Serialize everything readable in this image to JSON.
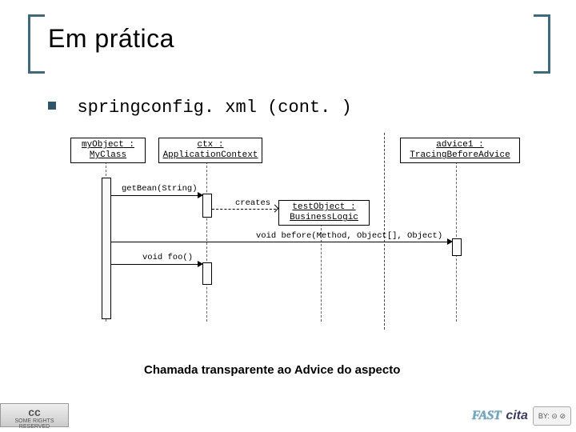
{
  "title": "Em prática",
  "bullet": "springconfig. xml (cont. )",
  "caption": "Chamada transparente ao Advice do aspecto",
  "footer": {
    "left_top": "cc",
    "left_bottom": "SOME RIGHTS RESERVED",
    "fast": "FAST",
    "cita": "cita",
    "by": "BY:"
  },
  "chart_data": {
    "type": "sequence-diagram",
    "objects": [
      {
        "name": "myObject",
        "class": "MyClass",
        "kind": "header"
      },
      {
        "name": "ctx",
        "class": "ApplicationContext",
        "kind": "header"
      },
      {
        "name": "testObject",
        "class": "BusinessLogic",
        "kind": "created-midway"
      },
      {
        "name": "advice1",
        "class": "TracingBeforeAdvice",
        "kind": "header"
      }
    ],
    "messages": [
      {
        "from": "myObject",
        "to": "ctx",
        "label": "getBean(String)",
        "style": "sync"
      },
      {
        "from": "ctx",
        "to": "testObject",
        "label": "creates",
        "style": "dashed"
      },
      {
        "from": "myObject",
        "to": "advice1",
        "label": "void before(Method, Object[], Object)",
        "style": "sync"
      },
      {
        "from": "myObject",
        "to": "ctx",
        "label": "void foo()",
        "style": "sync"
      }
    ],
    "group_separator_after": "ctx"
  }
}
